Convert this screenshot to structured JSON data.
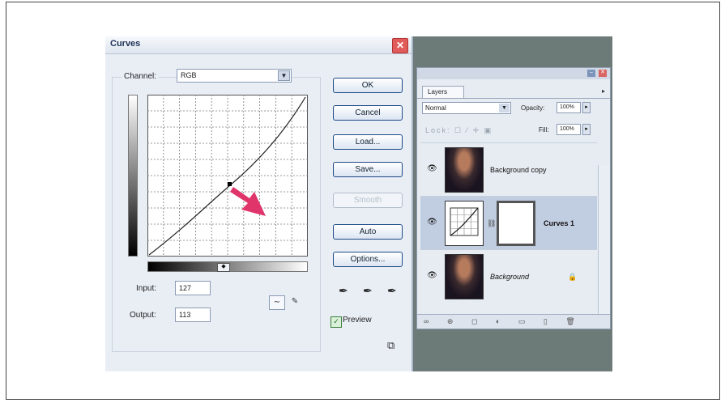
{
  "curves": {
    "title": "Curves",
    "close": "✕",
    "channel_label": "Channel:",
    "channel_value": "RGB",
    "input_label": "Input:",
    "input_value": "127",
    "output_label": "Output:",
    "output_value": "113",
    "buttons": {
      "ok": "OK",
      "cancel": "Cancel",
      "load": "Load...",
      "save": "Save...",
      "smooth": "Smooth",
      "auto": "Auto",
      "options": "Options..."
    },
    "preview_label": "Preview",
    "preview_checked": true,
    "curve_point": {
      "input": 127,
      "output": 113
    },
    "arrow_color": "#e0356a"
  },
  "layers": {
    "tab": "Layers",
    "blend_mode": "Normal",
    "opacity_label": "Opacity:",
    "opacity_value": "100%",
    "lock_label": "Lock:",
    "fill_label": "Fill:",
    "fill_value": "100%",
    "items": [
      {
        "name": "Background copy",
        "type": "photo",
        "selected": false
      },
      {
        "name": "Curves 1",
        "type": "adjustment",
        "selected": true
      },
      {
        "name": "Background",
        "type": "photo",
        "selected": false,
        "locked": true
      }
    ]
  }
}
